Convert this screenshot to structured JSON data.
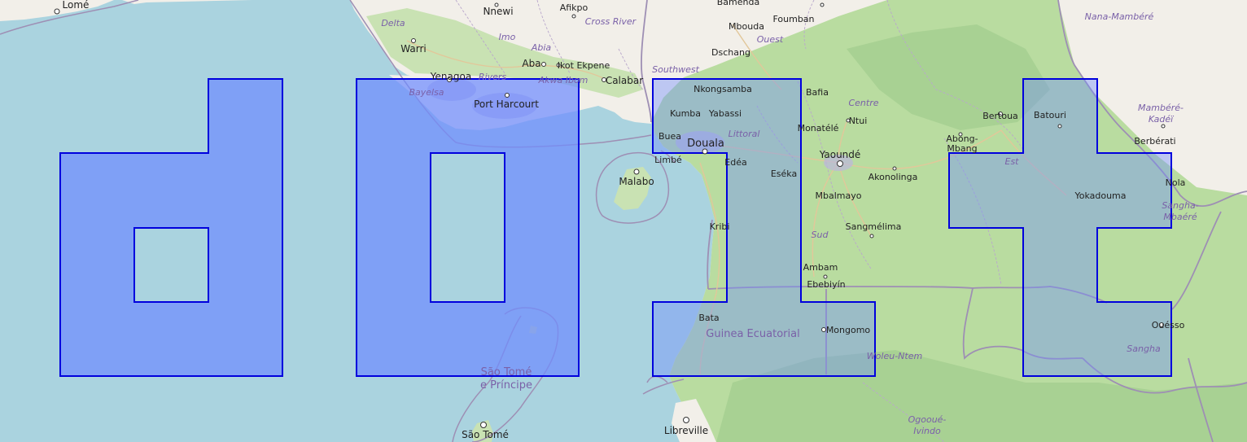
{
  "map": {
    "colors": {
      "water": "#aad3df",
      "land": "#f2efe9",
      "forest": "#b9dca0",
      "forest_dark": "#a8d193",
      "wetland": "#c8d8c8",
      "border": "#9e8fb4",
      "road": "#e2c79a",
      "overlay_fill": "#6f8cff",
      "overlay_stroke": "#0000dd",
      "text_city": "#222222",
      "text_region": "#7a61a8"
    },
    "overlay_shapes": [
      "letter-d",
      "letter-o",
      "letter-l",
      "letter-t"
    ],
    "region_labels": {
      "delta": "Delta",
      "imo": "Imo",
      "abia": "Abia",
      "cross_river": "Cross River",
      "rivers": "Rivers",
      "akwa_ibom": "Akwa Ibom",
      "bayelsa": "Bayelsa",
      "southwest": "Southwest",
      "ouest": "Ouest",
      "littoral": "Littoral",
      "centre": "Centre",
      "sud": "Sud",
      "est": "Est",
      "nana_mambere": "Nana-Mambéré",
      "mambere_kadei_1": "Mambéré-",
      "mambere_kadei_2": "Kadéï",
      "sangha_mbaere_1": "Sangha-",
      "sangha_mbaere_2": "Mbaéré",
      "sangha": "Sangha",
      "woleu_ntem": "Woleu-Ntem",
      "ogooue_ivindo_1": "Ogooué-",
      "ogooue_ivindo_2": "Ivindo"
    },
    "country_labels": {
      "guinea_ecuatorial": "Guinea Ecuatorial",
      "sao_tome_1": "São Tomé",
      "sao_tome_2": "e Príncipe"
    },
    "city_labels": {
      "lome": "Lomé",
      "nnewi": "Nnewi",
      "afikpo": "Afikpo",
      "bamenda": "Bamenda",
      "foumban": "Foumban",
      "mbouda": "Mbouda",
      "dschang": "Dschang",
      "warri": "Warri",
      "aba": "Aba",
      "ikot_ekpene": "Ikot Ekpene",
      "yenagoa": "Yenagoa",
      "calabar": "Calabar",
      "port_harcourt": "Port Harcourt",
      "nkongsamba": "Nkongsamba",
      "kumba": "Kumba",
      "yabassi": "Yabassi",
      "bafia": "Bafia",
      "buea": "Buea",
      "douala": "Douala",
      "limbe": "Limbé",
      "malabo": "Malabo",
      "monatele": "Monatélé",
      "ntui": "Ntui",
      "edea": "Edéa",
      "eseka": "Eséka",
      "yaounde": "Yaoundé",
      "akonolinga": "Akonolinga",
      "mbalmayo": "Mbalmayo",
      "bertoua": "Bertoua",
      "batouri": "Batouri",
      "abong_mbang_1": "Abong-",
      "abong_mbang_2": "Mbang",
      "yokadouma": "Yokadouma",
      "berberati": "Berbérati",
      "nola": "Nola",
      "kribi": "Kribi",
      "sangmelima": "Sangmélima",
      "ambam": "Ambam",
      "ebebiyin": "Ebebiyín",
      "bata": "Bata",
      "mongomo": "Mongomo",
      "ouesso": "Ouésso",
      "libreville": "Libreville",
      "sao_tome_city": "São Tomé"
    }
  }
}
